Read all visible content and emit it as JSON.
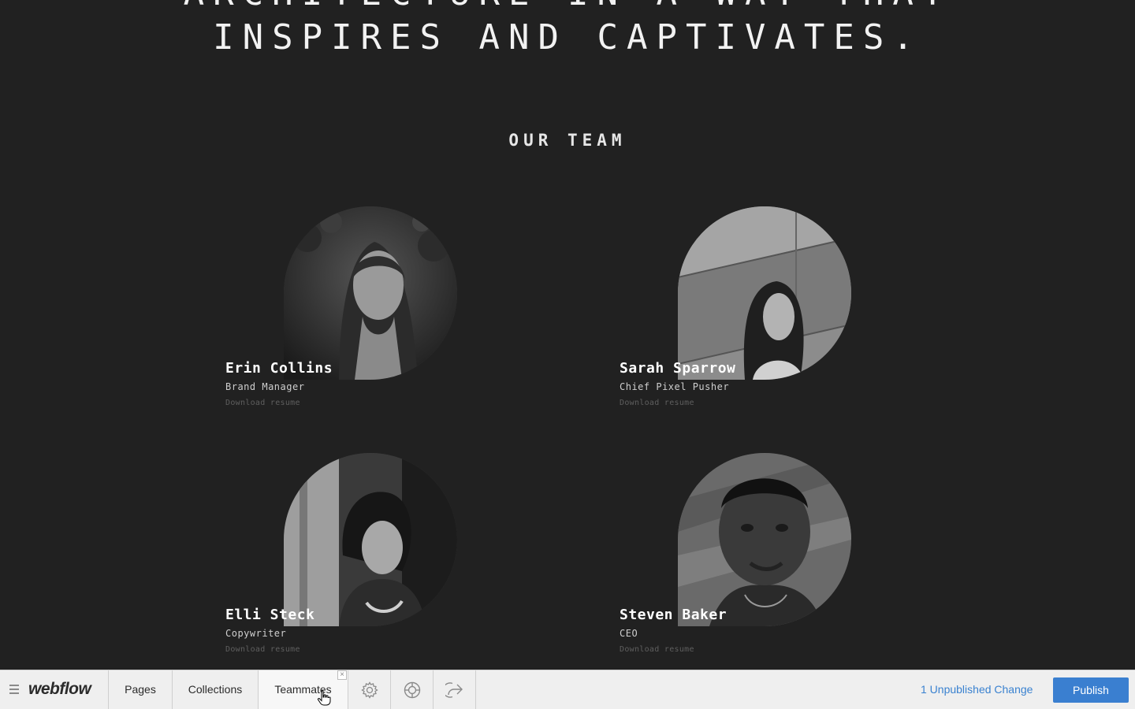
{
  "hero": {
    "line1": "ARCHITECTURE IN A WAY THAT",
    "line2": "INSPIRES AND CAPTIVATES."
  },
  "team": {
    "title": "OUR TEAM",
    "members": [
      {
        "name": "Erin Collins",
        "role": "Brand Manager",
        "link": "Download resume"
      },
      {
        "name": "Sarah Sparrow",
        "role": "Chief Pixel Pusher",
        "link": "Download resume"
      },
      {
        "name": "Elli Steck",
        "role": "Copywriter",
        "link": "Download resume"
      },
      {
        "name": "Steven Baker",
        "role": "CEO",
        "link": "Download resume"
      }
    ]
  },
  "webflow_bar": {
    "logo": "webflow",
    "tabs": [
      "Pages",
      "Collections",
      "Teammates"
    ],
    "close_glyph": "×",
    "icons": [
      "gear-icon",
      "help-lifebuoy-icon",
      "export-share-icon"
    ],
    "unpublished": "1 Unpublished Change",
    "publish": "Publish",
    "colors": {
      "publish": "#3a7fd0",
      "link": "#3a82d0",
      "bar_bg": "#efefef"
    }
  }
}
